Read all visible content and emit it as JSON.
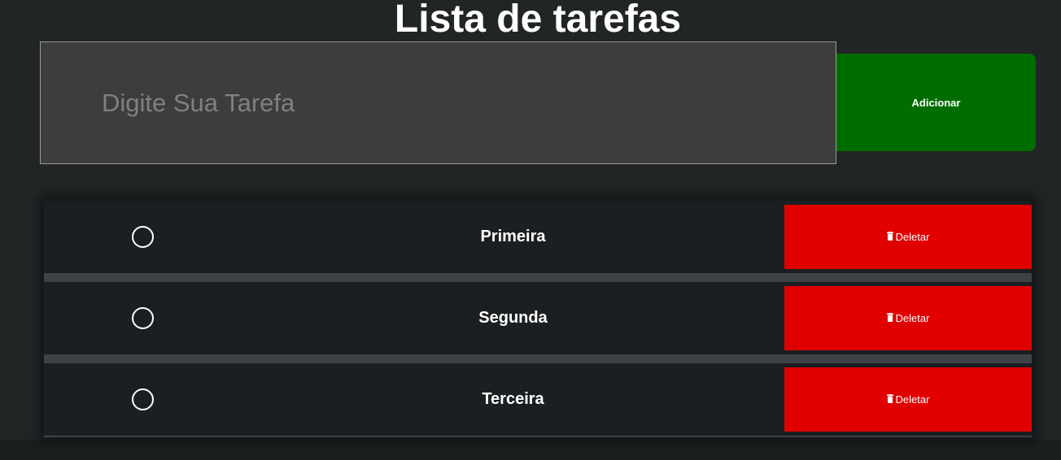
{
  "header": {
    "title": "Lista de tarefas"
  },
  "form": {
    "input_placeholder": "Digite Sua Tarefa",
    "input_value": "",
    "add_label": "Adicionar"
  },
  "tasks": [
    {
      "label": "Primeira",
      "done": false,
      "delete_label": "Deletar"
    },
    {
      "label": "Segunda",
      "done": false,
      "delete_label": "Deletar"
    },
    {
      "label": "Terceira",
      "done": false,
      "delete_label": "Deletar"
    }
  ],
  "icons": {
    "checkbox": "circle-outline-icon",
    "delete": "trash-icon"
  },
  "colors": {
    "background": "#212526",
    "input_background": "#3d3d3d",
    "add_button": "#006d00",
    "delete_button": "#e00000",
    "task_row": "#1c1f21",
    "text": "#ffffff"
  }
}
